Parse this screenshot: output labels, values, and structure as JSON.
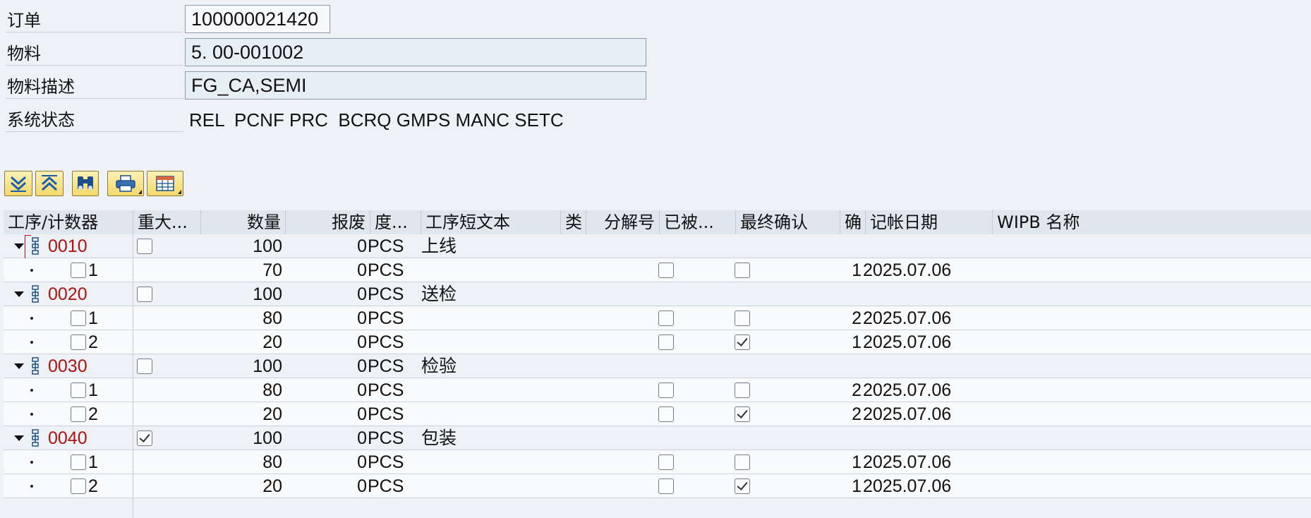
{
  "header": {
    "order_label": "订单",
    "order_value": "100000021420",
    "material_label": "物料",
    "material_value": "5. 00-001002",
    "material_desc_label": "物料描述",
    "material_desc_value": "FG_CA,SEMI",
    "system_status_label": "系统状态",
    "system_status_value": "REL  PCNF PRC  BCRQ GMPS MANC SETC"
  },
  "toolbar": {
    "buttons": [
      "expand-all-icon",
      "collapse-all-icon",
      "find-icon",
      "print-icon",
      "layout-icon"
    ]
  },
  "grid": {
    "columns": {
      "op_counter": "工序/计数器",
      "major": "重大...",
      "quantity": "数量",
      "scrap": "报废",
      "uom": "度...",
      "op_text": "工序短文本",
      "type": "类",
      "split": "分解号",
      "reversed": "已被...",
      "final_conf": "最终确认",
      "conf": "确",
      "posting_date": "记帐日期",
      "wipb_name": "WIPB 名称"
    },
    "operations": [
      {
        "op": "0010",
        "major": false,
        "qty": "100",
        "scrap": "0",
        "uom": "PCS",
        "text": "上线",
        "confirmations": [
          {
            "counter": "1",
            "qty": "70",
            "scrap": "0",
            "uom": "PCS",
            "reversed": false,
            "final": false,
            "conf": "1",
            "date": "2025.07.06"
          }
        ]
      },
      {
        "op": "0020",
        "major": false,
        "qty": "100",
        "scrap": "0",
        "uom": "PCS",
        "text": "送检",
        "confirmations": [
          {
            "counter": "1",
            "qty": "80",
            "scrap": "0",
            "uom": "PCS",
            "reversed": false,
            "final": false,
            "conf": "2",
            "date": "2025.07.06"
          },
          {
            "counter": "2",
            "qty": "20",
            "scrap": "0",
            "uom": "PCS",
            "reversed": false,
            "final": true,
            "conf": "1",
            "date": "2025.07.06"
          }
        ]
      },
      {
        "op": "0030",
        "major": false,
        "qty": "100",
        "scrap": "0",
        "uom": "PCS",
        "text": "检验",
        "confirmations": [
          {
            "counter": "1",
            "qty": "80",
            "scrap": "0",
            "uom": "PCS",
            "reversed": false,
            "final": false,
            "conf": "2",
            "date": "2025.07.06"
          },
          {
            "counter": "2",
            "qty": "20",
            "scrap": "0",
            "uom": "PCS",
            "reversed": false,
            "final": true,
            "conf": "2",
            "date": "2025.07.06"
          }
        ]
      },
      {
        "op": "0040",
        "major": true,
        "qty": "100",
        "scrap": "0",
        "uom": "PCS",
        "text": "包装",
        "confirmations": [
          {
            "counter": "1",
            "qty": "80",
            "scrap": "0",
            "uom": "PCS",
            "reversed": false,
            "final": false,
            "conf": "1",
            "date": "2025.07.06"
          },
          {
            "counter": "2",
            "qty": "20",
            "scrap": "0",
            "uom": "PCS",
            "reversed": false,
            "final": true,
            "conf": "1",
            "date": "2025.07.06"
          }
        ]
      }
    ]
  }
}
